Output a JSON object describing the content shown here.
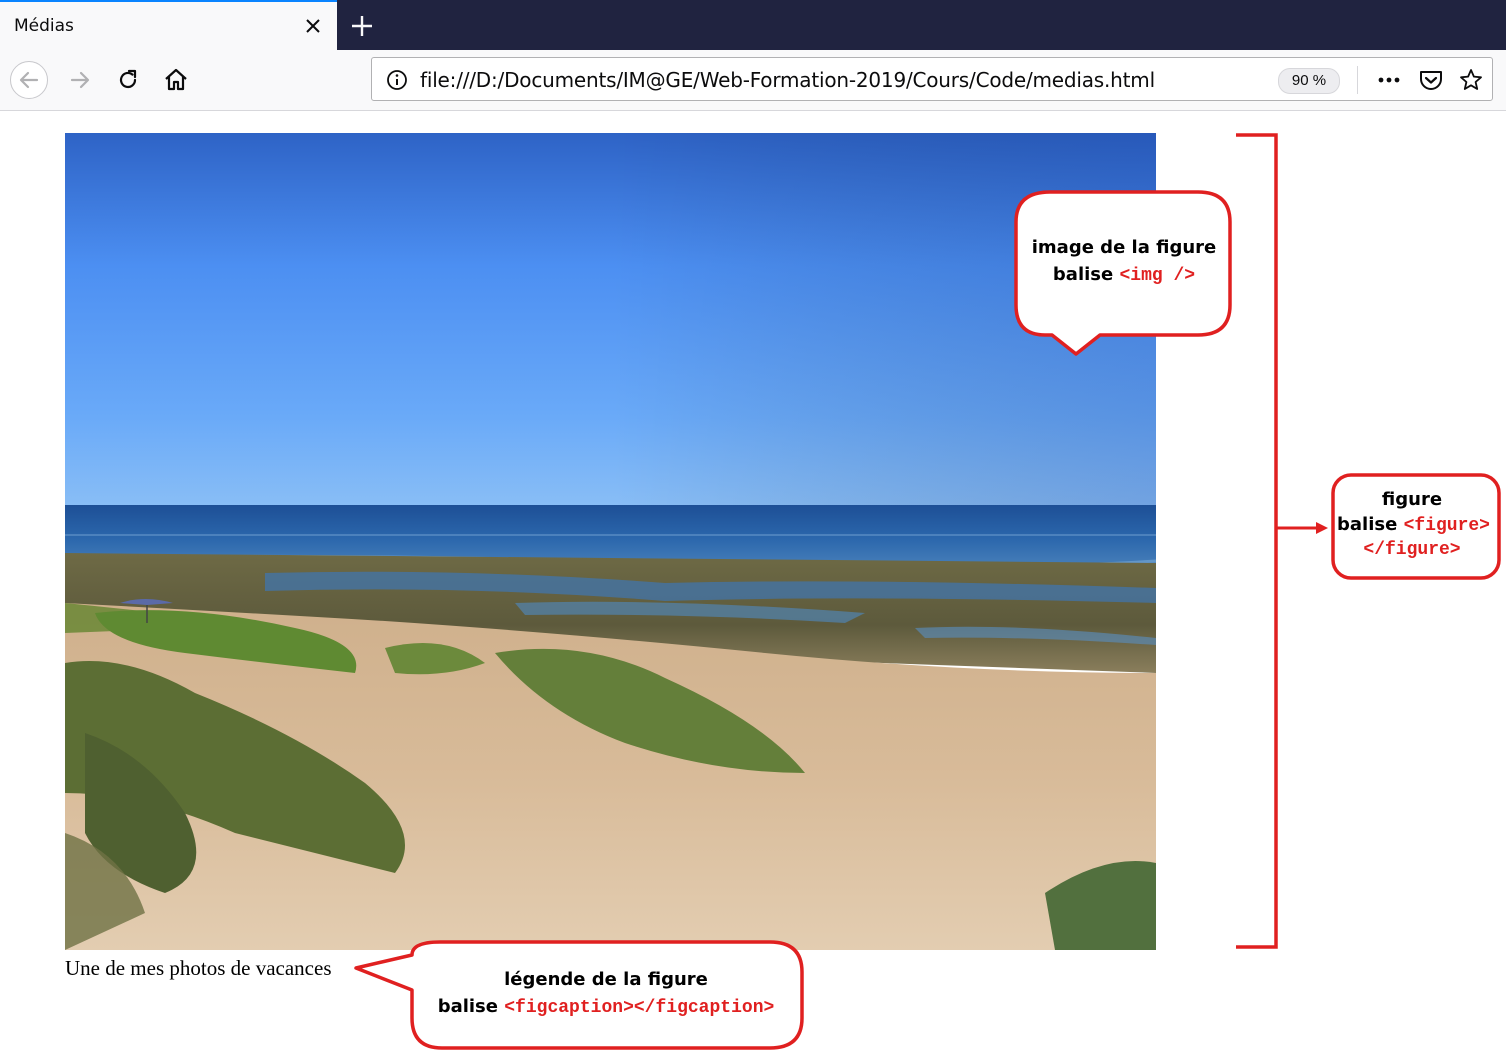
{
  "browser": {
    "tab_title": "Médias",
    "url": "file:///D:/Documents/IM@GE/Web-Formation-2019/Cours/Code/medias.html",
    "zoom": "90 %",
    "accent": "#0a84ff"
  },
  "figure": {
    "caption": "Une de mes photos de vacances",
    "image_subject": "beach-landscape"
  },
  "annotations": {
    "img": {
      "title": "image de la figure",
      "prefix": "balise ",
      "code": "<img />"
    },
    "figure": {
      "title": "figure",
      "prefix": "balise ",
      "code1": "<figure>",
      "code2": "</figure>"
    },
    "figcaption": {
      "title": "légende de la figure",
      "prefix": "balise ",
      "code": "<figcaption></figcaption>"
    },
    "color": "#e02020"
  }
}
